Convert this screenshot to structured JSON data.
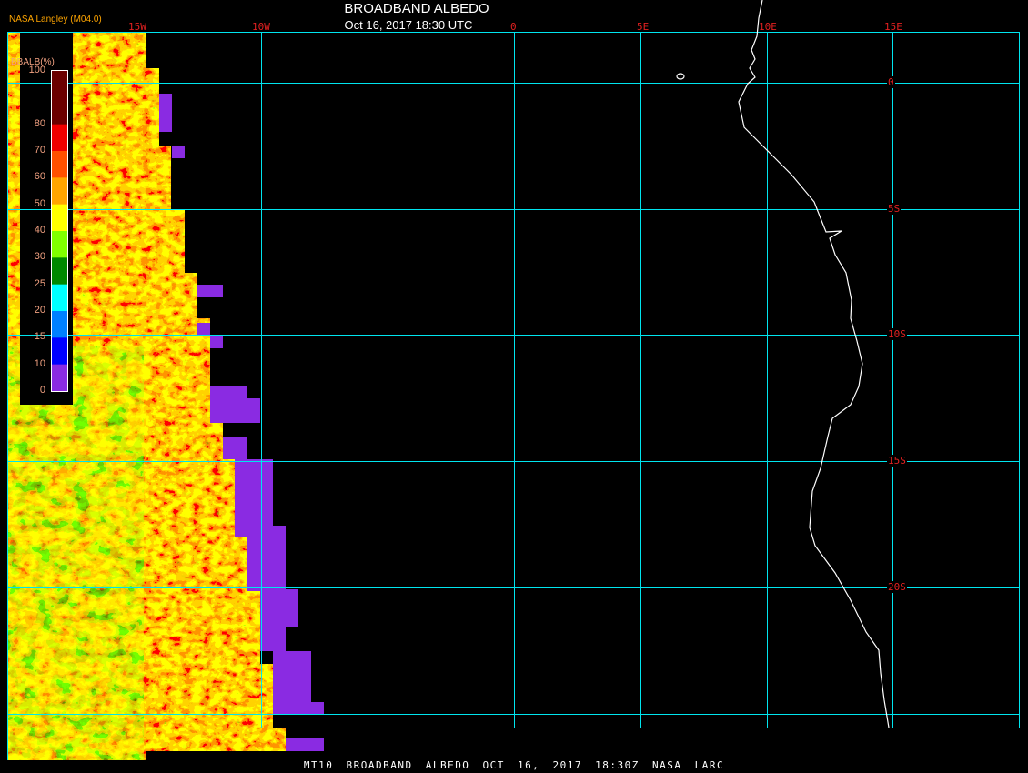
{
  "title": "BROADBAND ALBEDO",
  "subtitle": "Oct 16, 2017 18:30 UTC",
  "producer": "NASA Langley (M04.0)",
  "footer": "MT10  BROADBAND ALBEDO   OCT 16, 2017 18:30Z   NASA LARC",
  "legend": {
    "title": "BBALB(%)",
    "ticks": [
      "100",
      "80",
      "70",
      "60",
      "50",
      "40",
      "30",
      "25",
      "20",
      "15",
      "10",
      "0"
    ],
    "bins": [
      {
        "range": "90-100",
        "color": "#6b0000"
      },
      {
        "range": "80-90",
        "color": "#6b0000"
      },
      {
        "range": "70-80",
        "color": "#f00000"
      },
      {
        "range": "60-70",
        "color": "#ff5000"
      },
      {
        "range": "50-60",
        "color": "#ffa500"
      },
      {
        "range": "40-50",
        "color": "#ffff00"
      },
      {
        "range": "30-40",
        "color": "#80ff00"
      },
      {
        "range": "25-30",
        "color": "#008800"
      },
      {
        "range": "20-25",
        "color": "#00ffff"
      },
      {
        "range": "15-20",
        "color": "#0080ff"
      },
      {
        "range": "10-15",
        "color": "#0000ff"
      },
      {
        "range": "0-10",
        "color": "#8a2be2"
      }
    ]
  },
  "longitude_labels": [
    "15W",
    "10W",
    "0",
    "5E",
    "10E",
    "15E"
  ],
  "latitude_labels": [
    "0",
    "5S",
    "10S",
    "15S",
    "20S"
  ],
  "colors": {
    "grid": "#00e5ee",
    "coast": "#ffffff",
    "label": "#e02020"
  }
}
